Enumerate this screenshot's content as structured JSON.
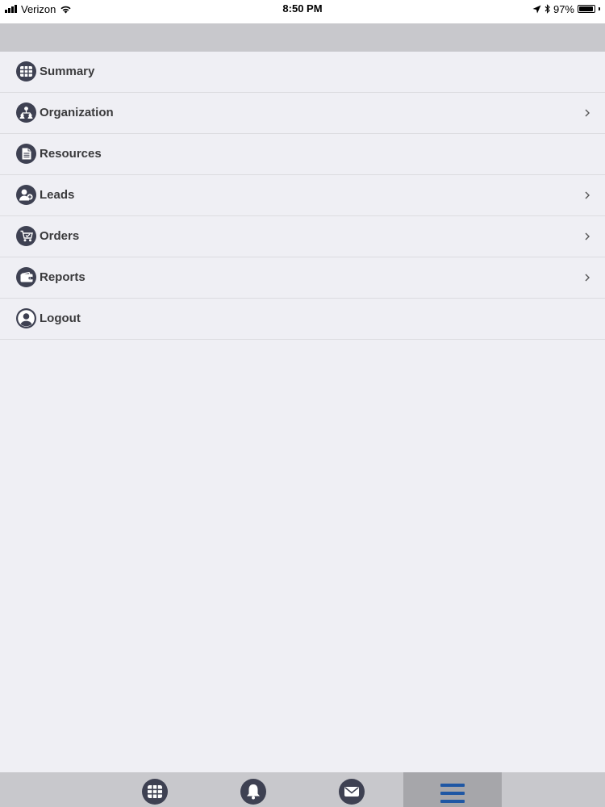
{
  "status_bar": {
    "carrier": "Verizon",
    "time": "8:50 PM",
    "battery": "97%",
    "battery_level": 0.97,
    "icons": [
      "signal-bars-icon",
      "wifi-icon",
      "location-arrow-icon",
      "bluetooth-icon",
      "battery-icon"
    ]
  },
  "colors": {
    "background": "#efeff4",
    "bar": "#c8c8cc",
    "active_tab": "#a6a6aa",
    "icon": "#3e4152",
    "accent": "#1f57a4"
  },
  "menu": {
    "items": [
      {
        "label": "Summary",
        "icon": "grid-icon",
        "has_chevron": false
      },
      {
        "label": "Organization",
        "icon": "org-chart-icon",
        "has_chevron": true
      },
      {
        "label": "Resources",
        "icon": "document-icon",
        "has_chevron": false
      },
      {
        "label": "Leads",
        "icon": "add-user-icon",
        "has_chevron": true
      },
      {
        "label": "Orders",
        "icon": "cart-icon",
        "has_chevron": true
      },
      {
        "label": "Reports",
        "icon": "wallet-icon",
        "has_chevron": true
      },
      {
        "label": "Logout",
        "icon": "user-icon",
        "has_chevron": false
      }
    ]
  },
  "tab_bar": {
    "tabs": [
      {
        "icon": "grid-icon",
        "active": false
      },
      {
        "icon": "bell-icon",
        "active": false
      },
      {
        "icon": "mail-icon",
        "active": false
      },
      {
        "icon": "menu-icon",
        "active": true
      }
    ]
  }
}
